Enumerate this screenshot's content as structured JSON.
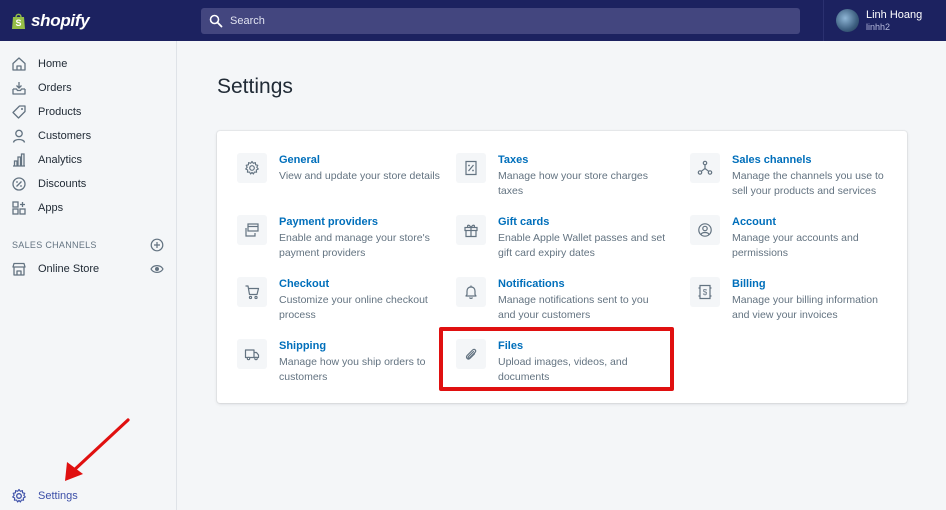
{
  "brand": {
    "name": "shopify"
  },
  "search": {
    "placeholder": "Search"
  },
  "user": {
    "name": "Linh Hoang",
    "handle": "linhh2"
  },
  "sidebar": {
    "items": [
      {
        "label": "Home",
        "icon": "home-icon"
      },
      {
        "label": "Orders",
        "icon": "orders-icon"
      },
      {
        "label": "Products",
        "icon": "tag-icon"
      },
      {
        "label": "Customers",
        "icon": "person-icon"
      },
      {
        "label": "Analytics",
        "icon": "bar-chart-icon"
      },
      {
        "label": "Discounts",
        "icon": "discount-icon"
      },
      {
        "label": "Apps",
        "icon": "apps-icon"
      }
    ],
    "sales_channels_label": "SALES CHANNELS",
    "online_store": {
      "label": "Online Store",
      "icon": "store-icon"
    },
    "settings": {
      "label": "Settings",
      "icon": "gear-icon"
    }
  },
  "main": {
    "title": "Settings",
    "settings": [
      {
        "title": "General",
        "desc": "View and update your store details",
        "icon": "gear-icon"
      },
      {
        "title": "Taxes",
        "desc": "Manage how your store charges taxes",
        "icon": "tax-icon"
      },
      {
        "title": "Sales channels",
        "desc": "Manage the channels you use to sell your products and services",
        "icon": "channels-icon"
      },
      {
        "title": "Payment providers",
        "desc": "Enable and manage your store's payment providers",
        "icon": "payment-icon"
      },
      {
        "title": "Gift cards",
        "desc": "Enable Apple Wallet passes and set gift card expiry dates",
        "icon": "gift-icon"
      },
      {
        "title": "Account",
        "desc": "Manage your accounts and permissions",
        "icon": "account-icon"
      },
      {
        "title": "Checkout",
        "desc": "Customize your online checkout process",
        "icon": "cart-icon"
      },
      {
        "title": "Notifications",
        "desc": "Manage notifications sent to you and your customers",
        "icon": "bell-icon"
      },
      {
        "title": "Billing",
        "desc": "Manage your billing information and view your invoices",
        "icon": "billing-icon"
      },
      {
        "title": "Shipping",
        "desc": "Manage how you ship orders to customers",
        "icon": "truck-icon"
      },
      {
        "title": "Files",
        "desc": "Upload images, videos, and documents",
        "icon": "paperclip-icon"
      }
    ]
  },
  "colors": {
    "topbar": "#1c2260",
    "link": "#006fbb",
    "highlight": "#e01010",
    "settings_active": "#3c4fa8"
  }
}
